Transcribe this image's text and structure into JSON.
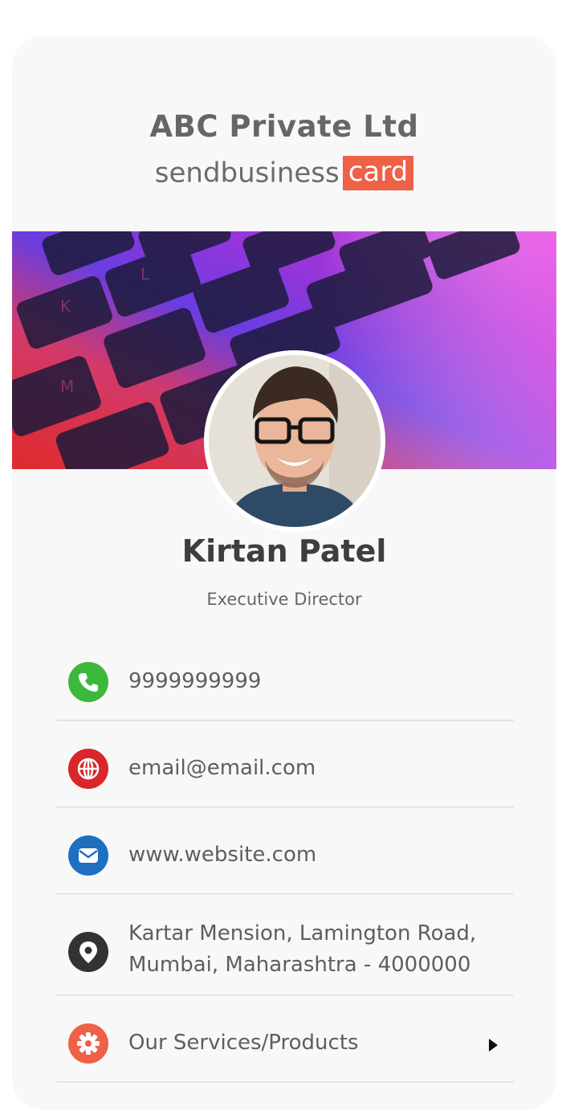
{
  "card": {
    "company": "ABC Private Ltd",
    "brand_text": "sendbusiness",
    "brand_badge": "card",
    "person": {
      "name": "Kirtan Patel",
      "title": "Executive Director"
    },
    "contacts": [
      {
        "type": "phone",
        "value": "9999999999",
        "icon": "phone-icon",
        "color": "#3cb83c"
      },
      {
        "type": "email",
        "value": "email@email.com",
        "icon": "globe-icon",
        "color": "#d9262a"
      },
      {
        "type": "website",
        "value": "www.website.com",
        "icon": "envelope-icon",
        "color": "#1e6fc0"
      },
      {
        "type": "address",
        "line1": "Kartar Mension, Lamington Road,",
        "line2": "Mumbai, Maharashtra - 4000000",
        "icon": "location-pin-icon",
        "color": "#333333"
      },
      {
        "type": "services",
        "value": "Our Services/Products",
        "icon": "gear-icon",
        "color": "#ee6146"
      }
    ]
  },
  "colors": {
    "brand_badge": "#ee6146",
    "card_background": "#f8f8f8"
  }
}
